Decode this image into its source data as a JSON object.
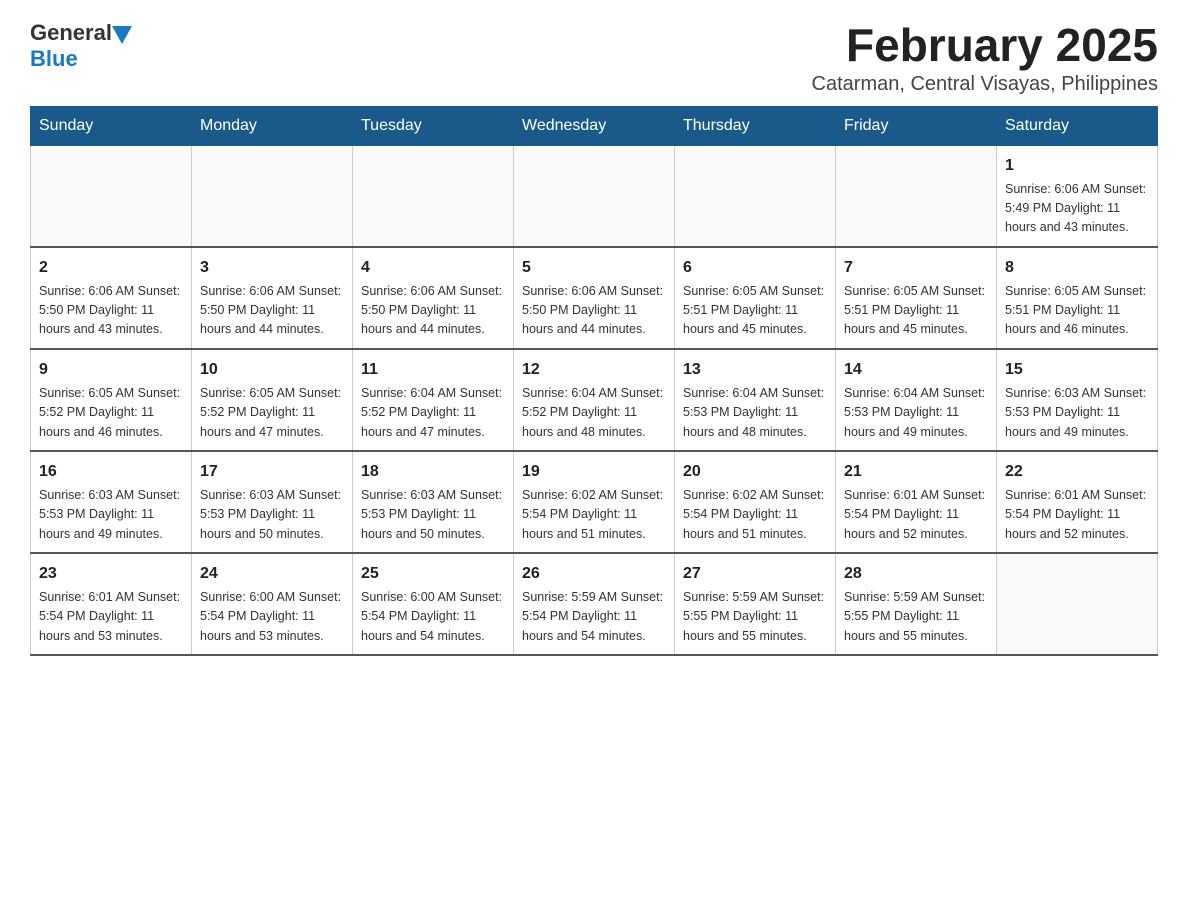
{
  "logo": {
    "general": "General",
    "blue": "Blue"
  },
  "header": {
    "title": "February 2025",
    "subtitle": "Catarman, Central Visayas, Philippines"
  },
  "weekdays": [
    "Sunday",
    "Monday",
    "Tuesday",
    "Wednesday",
    "Thursday",
    "Friday",
    "Saturday"
  ],
  "weeks": [
    [
      {
        "day": "",
        "info": ""
      },
      {
        "day": "",
        "info": ""
      },
      {
        "day": "",
        "info": ""
      },
      {
        "day": "",
        "info": ""
      },
      {
        "day": "",
        "info": ""
      },
      {
        "day": "",
        "info": ""
      },
      {
        "day": "1",
        "info": "Sunrise: 6:06 AM\nSunset: 5:49 PM\nDaylight: 11 hours\nand 43 minutes."
      }
    ],
    [
      {
        "day": "2",
        "info": "Sunrise: 6:06 AM\nSunset: 5:50 PM\nDaylight: 11 hours\nand 43 minutes."
      },
      {
        "day": "3",
        "info": "Sunrise: 6:06 AM\nSunset: 5:50 PM\nDaylight: 11 hours\nand 44 minutes."
      },
      {
        "day": "4",
        "info": "Sunrise: 6:06 AM\nSunset: 5:50 PM\nDaylight: 11 hours\nand 44 minutes."
      },
      {
        "day": "5",
        "info": "Sunrise: 6:06 AM\nSunset: 5:50 PM\nDaylight: 11 hours\nand 44 minutes."
      },
      {
        "day": "6",
        "info": "Sunrise: 6:05 AM\nSunset: 5:51 PM\nDaylight: 11 hours\nand 45 minutes."
      },
      {
        "day": "7",
        "info": "Sunrise: 6:05 AM\nSunset: 5:51 PM\nDaylight: 11 hours\nand 45 minutes."
      },
      {
        "day": "8",
        "info": "Sunrise: 6:05 AM\nSunset: 5:51 PM\nDaylight: 11 hours\nand 46 minutes."
      }
    ],
    [
      {
        "day": "9",
        "info": "Sunrise: 6:05 AM\nSunset: 5:52 PM\nDaylight: 11 hours\nand 46 minutes."
      },
      {
        "day": "10",
        "info": "Sunrise: 6:05 AM\nSunset: 5:52 PM\nDaylight: 11 hours\nand 47 minutes."
      },
      {
        "day": "11",
        "info": "Sunrise: 6:04 AM\nSunset: 5:52 PM\nDaylight: 11 hours\nand 47 minutes."
      },
      {
        "day": "12",
        "info": "Sunrise: 6:04 AM\nSunset: 5:52 PM\nDaylight: 11 hours\nand 48 minutes."
      },
      {
        "day": "13",
        "info": "Sunrise: 6:04 AM\nSunset: 5:53 PM\nDaylight: 11 hours\nand 48 minutes."
      },
      {
        "day": "14",
        "info": "Sunrise: 6:04 AM\nSunset: 5:53 PM\nDaylight: 11 hours\nand 49 minutes."
      },
      {
        "day": "15",
        "info": "Sunrise: 6:03 AM\nSunset: 5:53 PM\nDaylight: 11 hours\nand 49 minutes."
      }
    ],
    [
      {
        "day": "16",
        "info": "Sunrise: 6:03 AM\nSunset: 5:53 PM\nDaylight: 11 hours\nand 49 minutes."
      },
      {
        "day": "17",
        "info": "Sunrise: 6:03 AM\nSunset: 5:53 PM\nDaylight: 11 hours\nand 50 minutes."
      },
      {
        "day": "18",
        "info": "Sunrise: 6:03 AM\nSunset: 5:53 PM\nDaylight: 11 hours\nand 50 minutes."
      },
      {
        "day": "19",
        "info": "Sunrise: 6:02 AM\nSunset: 5:54 PM\nDaylight: 11 hours\nand 51 minutes."
      },
      {
        "day": "20",
        "info": "Sunrise: 6:02 AM\nSunset: 5:54 PM\nDaylight: 11 hours\nand 51 minutes."
      },
      {
        "day": "21",
        "info": "Sunrise: 6:01 AM\nSunset: 5:54 PM\nDaylight: 11 hours\nand 52 minutes."
      },
      {
        "day": "22",
        "info": "Sunrise: 6:01 AM\nSunset: 5:54 PM\nDaylight: 11 hours\nand 52 minutes."
      }
    ],
    [
      {
        "day": "23",
        "info": "Sunrise: 6:01 AM\nSunset: 5:54 PM\nDaylight: 11 hours\nand 53 minutes."
      },
      {
        "day": "24",
        "info": "Sunrise: 6:00 AM\nSunset: 5:54 PM\nDaylight: 11 hours\nand 53 minutes."
      },
      {
        "day": "25",
        "info": "Sunrise: 6:00 AM\nSunset: 5:54 PM\nDaylight: 11 hours\nand 54 minutes."
      },
      {
        "day": "26",
        "info": "Sunrise: 5:59 AM\nSunset: 5:54 PM\nDaylight: 11 hours\nand 54 minutes."
      },
      {
        "day": "27",
        "info": "Sunrise: 5:59 AM\nSunset: 5:55 PM\nDaylight: 11 hours\nand 55 minutes."
      },
      {
        "day": "28",
        "info": "Sunrise: 5:59 AM\nSunset: 5:55 PM\nDaylight: 11 hours\nand 55 minutes."
      },
      {
        "day": "",
        "info": ""
      }
    ]
  ]
}
